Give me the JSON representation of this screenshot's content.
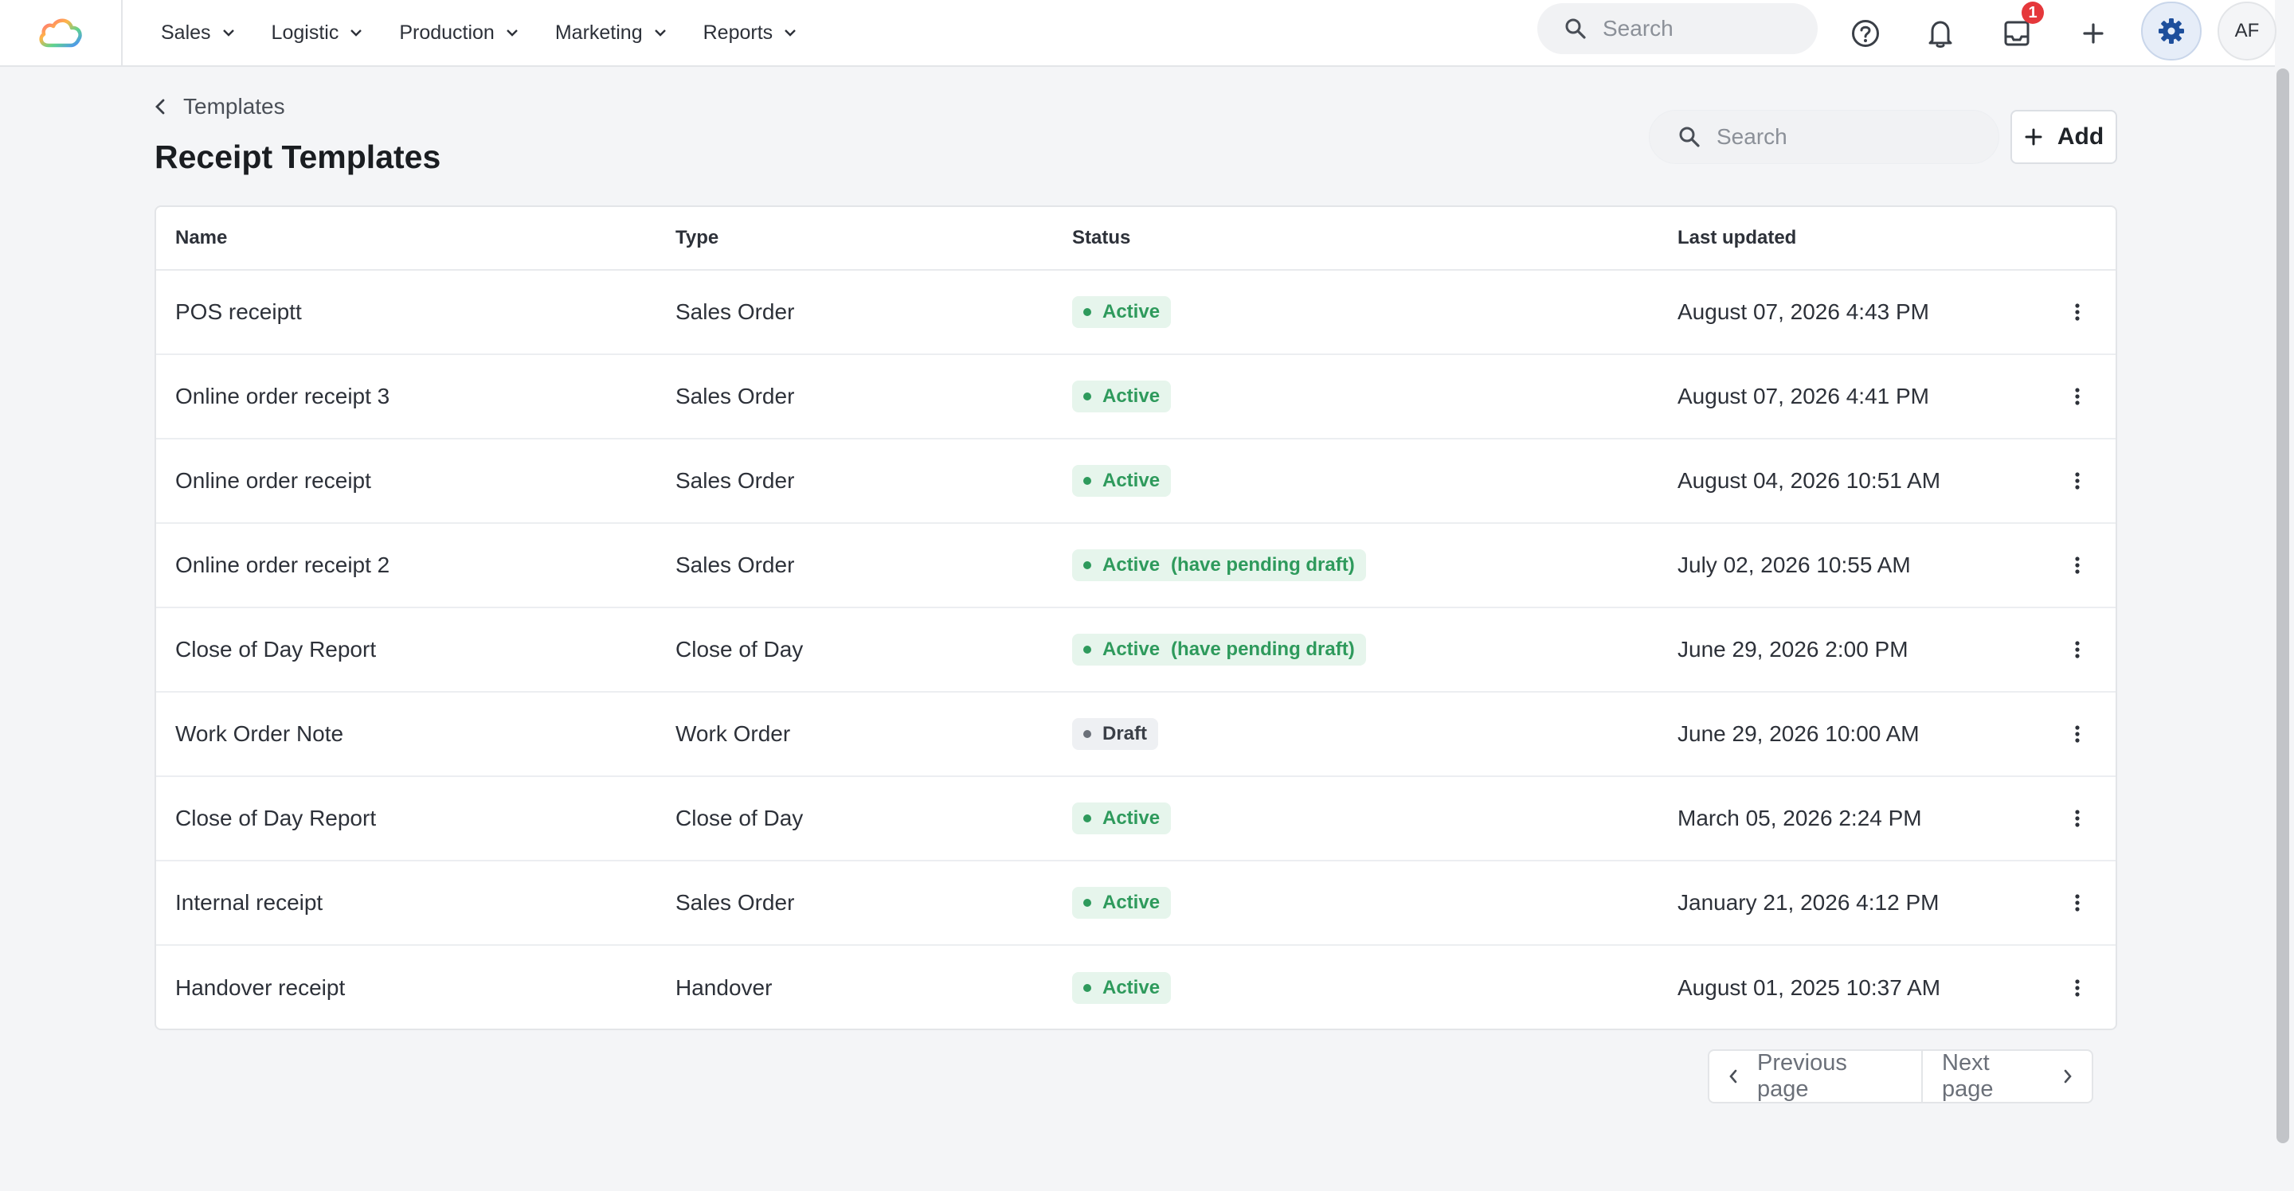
{
  "nav": {
    "items": [
      {
        "label": "Sales"
      },
      {
        "label": "Logistic"
      },
      {
        "label": "Production"
      },
      {
        "label": "Marketing"
      },
      {
        "label": "Reports"
      }
    ],
    "search_placeholder": "Search",
    "inbox_badge": "1",
    "avatar_initials": "AF"
  },
  "header": {
    "breadcrumb": "Templates",
    "title": "Receipt Templates",
    "search_placeholder": "Search",
    "add_label": "Add"
  },
  "table": {
    "columns": [
      "Name",
      "Type",
      "Status",
      "Last updated"
    ],
    "rows": [
      {
        "name": "POS receiptt",
        "type": "Sales Order",
        "status": "Active",
        "pending": "",
        "updated": "August 07, 2026 4:43 PM"
      },
      {
        "name": "Online order receipt 3",
        "type": "Sales Order",
        "status": "Active",
        "pending": "",
        "updated": "August 07, 2026 4:41 PM"
      },
      {
        "name": "Online order receipt",
        "type": "Sales Order",
        "status": "Active",
        "pending": "",
        "updated": "August 04, 2026 10:51 AM"
      },
      {
        "name": "Online order receipt 2",
        "type": "Sales Order",
        "status": "Active",
        "pending": "(have pending draft)",
        "updated": "July 02, 2026 10:55 AM"
      },
      {
        "name": "Close of Day Report",
        "type": "Close of Day",
        "status": "Active",
        "pending": "(have pending draft)",
        "updated": "June 29, 2026 2:00 PM"
      },
      {
        "name": "Work Order Note",
        "type": "Work Order",
        "status": "Draft",
        "pending": "",
        "updated": "June 29, 2026 10:00 AM"
      },
      {
        "name": "Close of Day Report",
        "type": "Close of Day",
        "status": "Active",
        "pending": "",
        "updated": "March 05, 2026 2:24 PM"
      },
      {
        "name": "Internal receipt",
        "type": "Sales Order",
        "status": "Active",
        "pending": "",
        "updated": "January 21, 2026 4:12 PM"
      },
      {
        "name": "Handover receipt",
        "type": "Handover",
        "status": "Active",
        "pending": "",
        "updated": "August 01, 2025 10:37 AM"
      }
    ]
  },
  "pagination": {
    "previous_label": "Previous page",
    "next_label": "Next page"
  },
  "colors": {
    "active": "#2e9a5c",
    "active_bg": "#e6f5ec",
    "badge": "#e5383b",
    "settings_icon": "#1e4f9c"
  },
  "icons": {
    "logo": "cloud-logo-icon",
    "nav_chevron": "chevron-down-icon",
    "search": "search-icon",
    "help": "help-circle-icon",
    "notifications": "bell-icon",
    "inbox": "inbox-icon",
    "create": "plus-icon",
    "settings": "gear-icon",
    "row_menu": "more-vertical-icon"
  }
}
